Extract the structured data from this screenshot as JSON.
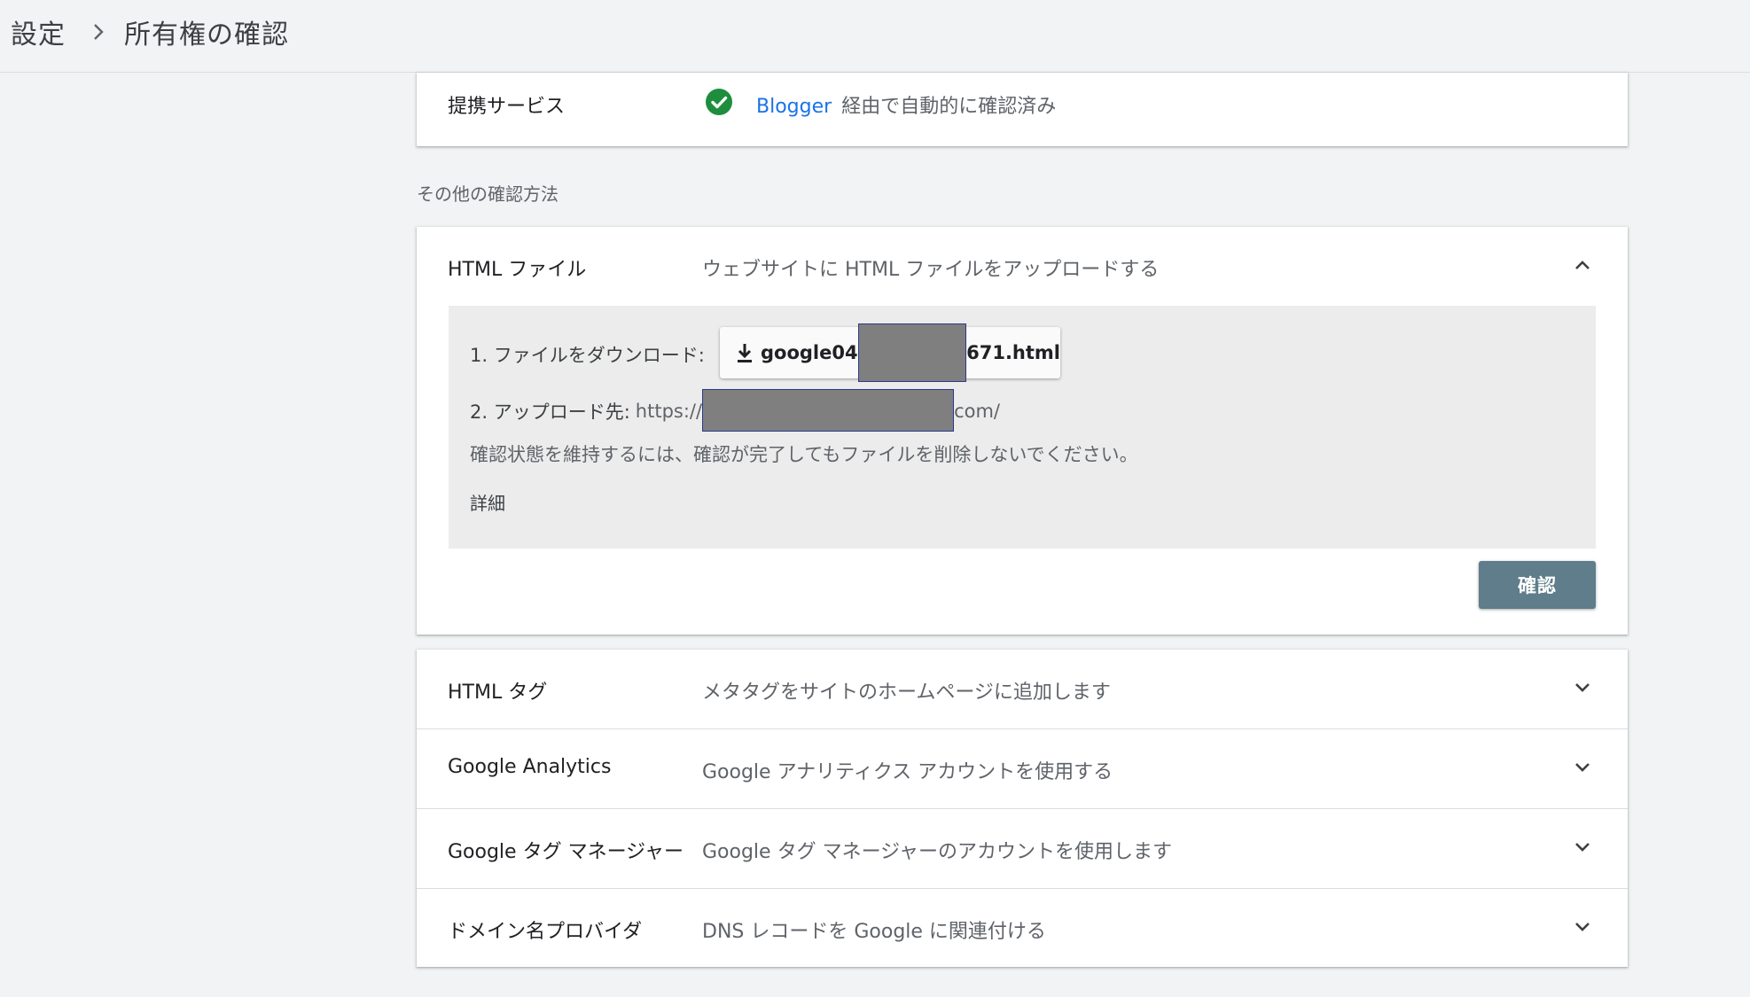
{
  "breadcrumb": {
    "parent": "設定",
    "current": "所有権の確認"
  },
  "partner_service": {
    "label": "提携サービス",
    "service_link": "Blogger",
    "status_text": "経由で自動的に確認済み",
    "status_color": "#1e8e3e"
  },
  "other_methods_title": "その他の確認方法",
  "html_file": {
    "label": "HTML ファイル",
    "description": "ウェブサイトに HTML ファイルをアップロードする",
    "expanded": true,
    "step1_label": "1. ファイルをダウンロード:",
    "download_prefix": "google04",
    "download_suffix": "671.html",
    "step2_label": "2. アップロード先:",
    "upload_prefix": "https://",
    "upload_suffix": "com/",
    "note": "確認状態を維持するには、確認が完了してもファイルを削除しないでください。",
    "details_link": "詳細",
    "verify_button": "確認"
  },
  "methods": [
    {
      "label": "HTML タグ",
      "description": "メタタグをサイトのホームページに追加します"
    },
    {
      "label": "Google Analytics",
      "description": "Google アナリティクス アカウントを使用する"
    },
    {
      "label": "Google タグ マネージャー",
      "description": "Google タグ マネージャーのアカウントを使用します"
    },
    {
      "label": "ドメイン名プロバイダ",
      "description": "DNS レコードを Google に関連付ける"
    }
  ],
  "colors": {
    "link": "#1a73e8",
    "verify_button_bg": "#5f7d8a",
    "redaction": "#7f7f7f"
  }
}
